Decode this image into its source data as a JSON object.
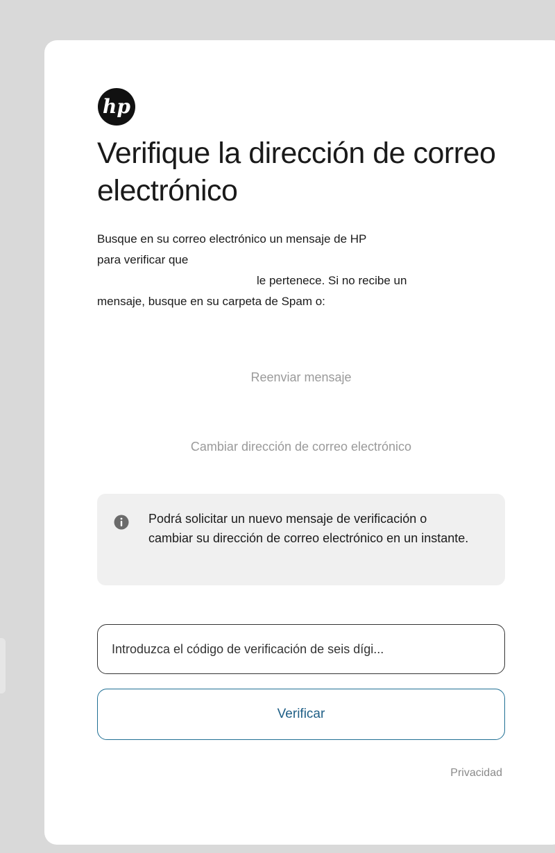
{
  "brand": {
    "logo_icon": "hp-logo-icon",
    "logo_text": "hp"
  },
  "header": {
    "title": "Verifique la dirección de correo electrónico"
  },
  "instructions": {
    "line1": "Busque en su correo electrónico un mensaje de HP",
    "line2": "para verificar que",
    "line3": "le pertenece. Si no recibe un",
    "line4": "mensaje, busque en su carpeta de Spam o:"
  },
  "actions": {
    "resend_label": "Reenviar mensaje",
    "change_email_label": "Cambiar dirección de correo electrónico"
  },
  "info": {
    "icon": "info-icon",
    "text": "Podrá solicitar un nuevo mensaje de verificación o cambiar su dirección de correo electrónico en un instante."
  },
  "code_field": {
    "value": "",
    "placeholder": "Introduzca el código de verificación de seis dígi..."
  },
  "verify_button": {
    "label": "Verificar"
  },
  "footer": {
    "privacy_label": "Privacidad"
  },
  "colors": {
    "background": "#d9d9d9",
    "card": "#ffffff",
    "accent": "#1f6f94",
    "muted_link": "#9a9a9a",
    "info_box": "#f0f0f0"
  }
}
